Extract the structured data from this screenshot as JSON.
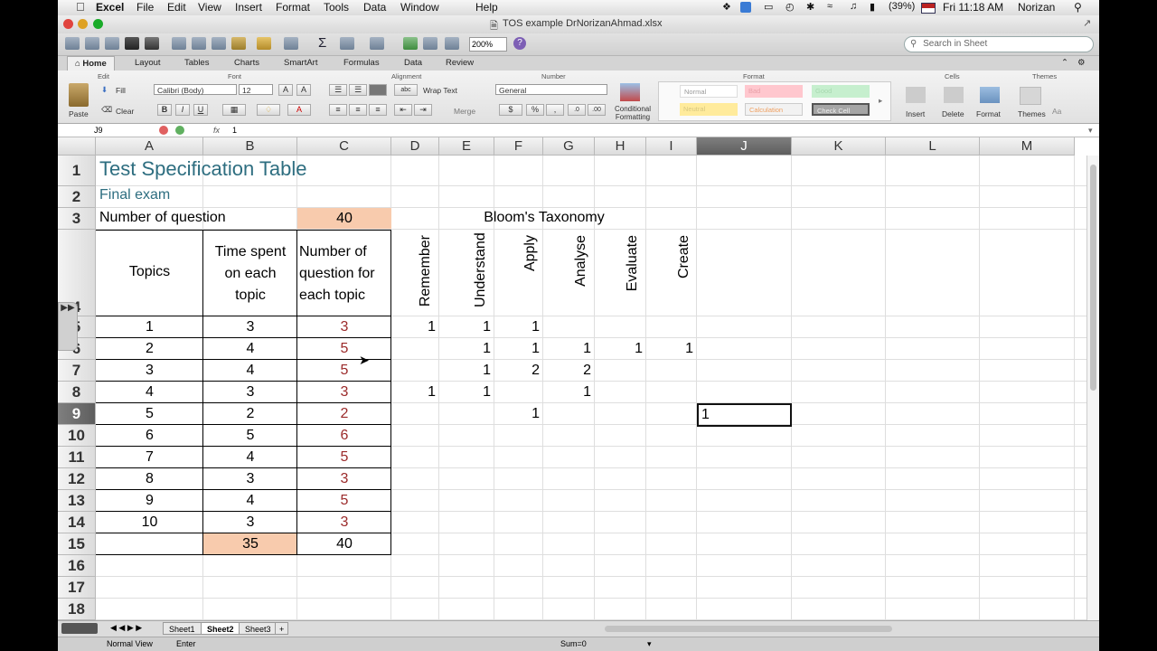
{
  "menubar": {
    "items": [
      "Excel",
      "File",
      "Edit",
      "View",
      "Insert",
      "Format",
      "Tools",
      "Data",
      "Window",
      "Help"
    ],
    "battery": "(39%)",
    "clock": "Fri 11:18 AM",
    "user": "Norizan"
  },
  "window": {
    "title": "TOS example DrNorizanAhmad.xlsx"
  },
  "toolbar": {
    "zoom": "200%",
    "search_placeholder": "Search in Sheet"
  },
  "ribbon": {
    "tabs": [
      "Home",
      "Layout",
      "Tables",
      "Charts",
      "SmartArt",
      "Formulas",
      "Data",
      "Review"
    ],
    "groups": {
      "edit": "Edit",
      "font": "Font",
      "alignment": "Alignment",
      "number": "Number",
      "format": "Format",
      "cells": "Cells",
      "themes": "Themes"
    },
    "paste": "Paste",
    "fill": "Fill",
    "clear": "Clear",
    "font_name": "Calibri (Body)",
    "font_size": "12",
    "wrap_text": "Wrap Text",
    "merge": "Merge",
    "number_format": "General",
    "conditional_formatting": "Conditional\nFormatting",
    "styles": [
      "Normal",
      "Bad",
      "Good",
      "Neutral",
      "Calculation",
      "Check Cell"
    ],
    "insert": "Insert",
    "delete": "Delete",
    "format": "Format",
    "themes": "Themes",
    "bold": "B",
    "italic": "I",
    "underline": "U",
    "percent": "%",
    "comma": ","
  },
  "formula_bar": {
    "name_box": "J9",
    "fx": "fx",
    "value": "1"
  },
  "columns": [
    "A",
    "B",
    "C",
    "D",
    "E",
    "F",
    "G",
    "H",
    "I",
    "J",
    "K",
    "L",
    "M"
  ],
  "selected_column": "J",
  "selected_row": "9",
  "rows": [
    "1",
    "2",
    "3",
    "4",
    "5",
    "6",
    "7",
    "8",
    "9",
    "10",
    "11",
    "12",
    "13",
    "14",
    "15",
    "16",
    "17",
    "18"
  ],
  "sheet": {
    "title": "Test Specification Table",
    "subtitle": "Final exam",
    "num_question_label": "Number of question",
    "num_question_value": "40",
    "bloom_header": "Bloom's Taxonomy",
    "hdr_topics": "Topics",
    "hdr_time": "Time spent\non each\ntopic",
    "hdr_numq": "Number of\nquestion for\neach topic",
    "bloom_levels": [
      "Remember",
      "Understand",
      "Apply",
      "Analyse",
      "Evaluate",
      "Create"
    ],
    "table_rows": [
      {
        "topic": "1",
        "time": "3",
        "numq": "3",
        "bloom": [
          "1",
          "1",
          "1",
          "",
          "",
          ""
        ]
      },
      {
        "topic": "2",
        "time": "4",
        "numq": "5",
        "bloom": [
          "",
          "1",
          "1",
          "1",
          "1",
          "1"
        ]
      },
      {
        "topic": "3",
        "time": "4",
        "numq": "5",
        "bloom": [
          "",
          "1",
          "2",
          "2",
          "",
          ""
        ]
      },
      {
        "topic": "4",
        "time": "3",
        "numq": "3",
        "bloom": [
          "1",
          "1",
          "",
          "1",
          "",
          ""
        ]
      },
      {
        "topic": "5",
        "time": "2",
        "numq": "2",
        "bloom": [
          "",
          "",
          "1",
          "",
          "",
          ""
        ]
      },
      {
        "topic": "6",
        "time": "5",
        "numq": "6",
        "bloom": [
          "",
          "",
          "",
          "",
          "",
          ""
        ]
      },
      {
        "topic": "7",
        "time": "4",
        "numq": "5",
        "bloom": [
          "",
          "",
          "",
          "",
          "",
          ""
        ]
      },
      {
        "topic": "8",
        "time": "3",
        "numq": "3",
        "bloom": [
          "",
          "",
          "",
          "",
          "",
          ""
        ]
      },
      {
        "topic": "9",
        "time": "4",
        "numq": "5",
        "bloom": [
          "",
          "",
          "",
          "",
          "",
          ""
        ]
      },
      {
        "topic": "10",
        "time": "3",
        "numq": "3",
        "bloom": [
          "",
          "",
          "",
          "",
          "",
          ""
        ]
      }
    ],
    "total_time": "35",
    "total_numq": "40",
    "j9_edit": "1"
  },
  "sheet_tabs": [
    "Sheet1",
    "Sheet2",
    "Sheet3"
  ],
  "active_sheet": "Sheet2",
  "status": {
    "view": "Normal View",
    "mode": "Enter",
    "sum": "Sum=0"
  }
}
